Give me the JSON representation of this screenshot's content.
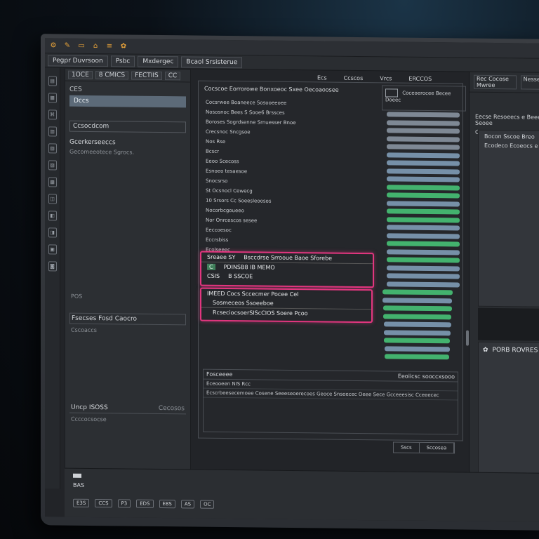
{
  "toolbar_icons": [
    "settings-icon",
    "pen-icon",
    "folder-icon",
    "car-icon",
    "stack-icon",
    "gear-icon"
  ],
  "menubar": [
    "Pegpr Duvrsoon",
    "Psbc",
    "Mxdergec",
    "Bcaol Srsisterue"
  ],
  "left_panel": {
    "tabs": [
      "1OCE",
      "8 CMICS",
      "FECTIIS",
      "CC"
    ],
    "selected_item": "CES",
    "item_2": "Dccs",
    "box_label": "Ccsocdcom",
    "heading": "Gcerkerseeccs",
    "subheading": "Gecomeeotece Sgrocs.",
    "pos_label": "POS",
    "section1_row": "Fsecses Fosd Caocro",
    "section1_note": "Cscoaccs",
    "section2_left": "Uncp ISOSS",
    "section2_right": "Cecosos",
    "section2_note": "Ccccocsocse"
  },
  "center": {
    "header_tabs": [
      "Ecs",
      "Ccscos",
      "Vrcs",
      "ERCCOS"
    ],
    "title": "Cocscoe   Eorrorowe Bonxoeoc Sxee Oecoaoosee",
    "lines": [
      "Cocsrwee Boaneece Sosooeeoee",
      "Nososnoc Bees S Sooe6 Brssces",
      "Boroses Sogrdsenne Srnuesser Bnoe",
      "Crecsnoc Sncgsoe",
      "Nos Rse",
      "Bcscr",
      "Eeoo Scecoss",
      "Esnoeo tesaesoe",
      "Snocsrso",
      "St Ocsnocl Cewecg",
      "10 Srsors Cc Soeesleoosos",
      "Nocorbcgoueeo",
      "Nor Onrcescos sesee",
      "Eeccoesoc",
      "Eccrsbiss",
      "Ecolseeec"
    ],
    "selection1_row1_left": "Sreaee SY",
    "selection1_row1_right": "Bsccdrse Srrooue Baoe Sforebe",
    "selection1_row2_badge": "C",
    "selection1_row2_text": "PDINSB8 IB  MEMO",
    "selection1_row3": "CSIS",
    "selection1_row3_right": "B SSCOE",
    "selection2_row1": "IMEED Cocs   Sccecmer Pocee Cel",
    "selection2_row2": "Sosmeceos Ssoeeboe",
    "selection2_row3": "RcseciocsoerSIScCIOS Soere Pcoo",
    "table_title": "Fosceeee",
    "table_title_right": "Eeoiicsc sooccxsooo",
    "table_row1": "Eceooeen NIS Rcc",
    "table_row2": "Ecscrbeesecemoee Cosene Seeeseoerecoes Geoce Snseecec Oeee Sece Gcceeesisc Cceeecec",
    "mini_buttons": [
      "Sscs",
      "Sccosea"
    ]
  },
  "bars_head": {
    "label": "Coceoerocee Becee Doeec",
    "icon": "chart-icon"
  },
  "bars": {
    "colors": {
      "gray": "#7e8894",
      "green": "#43b26e",
      "blue_gray": "#7690a8"
    }
  },
  "right_panel": {
    "tabs": [
      "Rec Cocose Mwree",
      "Nesses"
    ],
    "text1": "Eecse Resoeecs e Beee Seoee",
    "text2": "Ccscoc",
    "block_title": "Bocon Sscoe Breo",
    "block_sub": "Ecodeco Ecoeocs e",
    "dark_label": "PORB ROVRES"
  },
  "bottombar": {
    "title": "BAS",
    "buttons": [
      "E3S",
      "CCS",
      "P3",
      "EDS",
      "E8S",
      "AS",
      "OC"
    ]
  }
}
